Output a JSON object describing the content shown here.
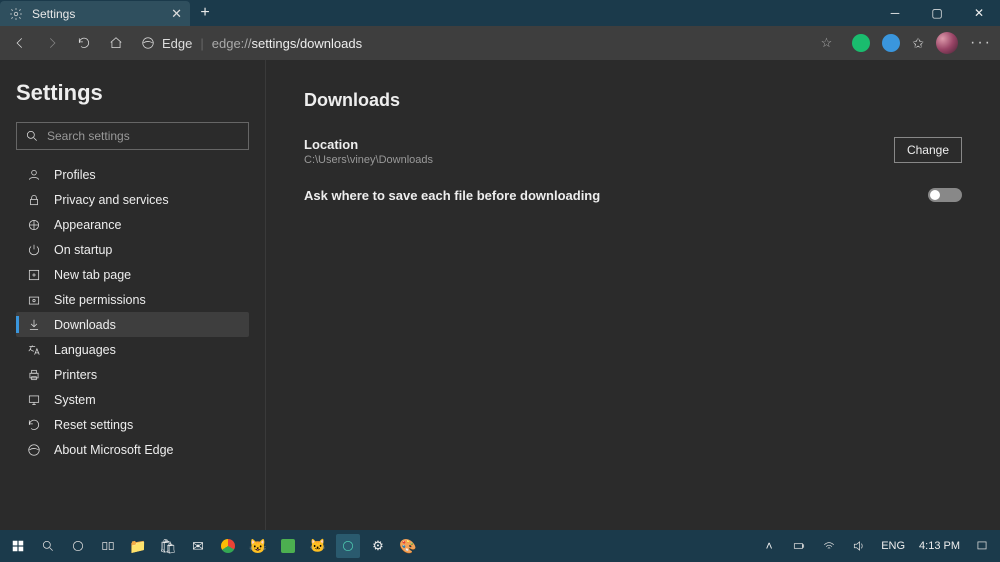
{
  "tab": {
    "title": "Settings"
  },
  "toolbar": {
    "edge_label": "Edge",
    "url_prefix": "edge://",
    "url_rest": "settings/downloads"
  },
  "sidebar": {
    "title": "Settings",
    "search_placeholder": "Search settings",
    "items": [
      {
        "label": "Profiles",
        "icon": "profile-icon"
      },
      {
        "label": "Privacy and services",
        "icon": "lock-icon"
      },
      {
        "label": "Appearance",
        "icon": "appearance-icon"
      },
      {
        "label": "On startup",
        "icon": "power-icon"
      },
      {
        "label": "New tab page",
        "icon": "newtab-icon"
      },
      {
        "label": "Site permissions",
        "icon": "permissions-icon"
      },
      {
        "label": "Downloads",
        "icon": "download-icon"
      },
      {
        "label": "Languages",
        "icon": "languages-icon"
      },
      {
        "label": "Printers",
        "icon": "printer-icon"
      },
      {
        "label": "System",
        "icon": "system-icon"
      },
      {
        "label": "Reset settings",
        "icon": "reset-icon"
      },
      {
        "label": "About Microsoft Edge",
        "icon": "about-icon"
      }
    ]
  },
  "main": {
    "heading": "Downloads",
    "location_label": "Location",
    "location_path": "C:\\Users\\viney\\Downloads",
    "change_button": "Change",
    "ask_label": "Ask where to save each file before downloading"
  },
  "taskbar": {
    "lang": "ENG",
    "time": "4:13 PM"
  }
}
